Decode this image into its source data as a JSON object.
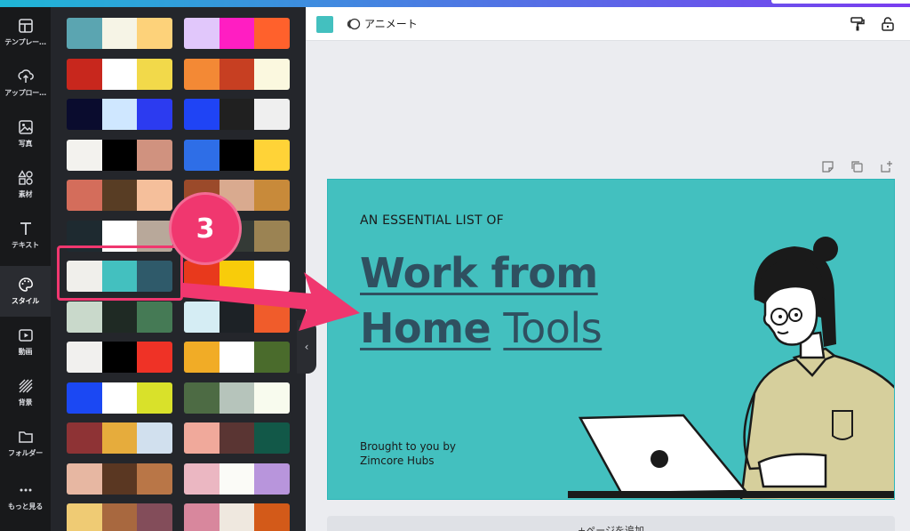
{
  "rail": {
    "items": [
      {
        "label": "テンプレー…",
        "icon": "template-icon"
      },
      {
        "label": "アップロー…",
        "icon": "upload-icon"
      },
      {
        "label": "写真",
        "icon": "photo-icon"
      },
      {
        "label": "素材",
        "icon": "elements-icon"
      },
      {
        "label": "テキスト",
        "icon": "text-icon"
      },
      {
        "label": "スタイル",
        "icon": "palette-icon"
      },
      {
        "label": "動画",
        "icon": "video-icon"
      },
      {
        "label": "背景",
        "icon": "background-icon"
      },
      {
        "label": "フォルダー",
        "icon": "folder-icon"
      },
      {
        "label": "もっと見る",
        "icon": "more-icon"
      }
    ]
  },
  "palettes": {
    "left": [
      [
        "#5ba5b1",
        "#f6f4e6",
        "#fdd27a"
      ],
      [
        "#c8271d",
        "#ffffff",
        "#f2d94a"
      ],
      [
        "#0a0c2e",
        "#cfe7ff",
        "#2c3bf0"
      ],
      [
        "#f3f2ee",
        "#000000",
        "#d0927f"
      ],
      [
        "#d46d5b",
        "#583d24",
        "#f5bf9b"
      ],
      [
        "#1e2a30",
        "#ffffff",
        "#b8a89a"
      ],
      [
        "#f0efeb",
        "#43c0bf",
        "#2f5a6a"
      ],
      [
        "#c9d9cb",
        "#1f2a24",
        "#457a55"
      ],
      [
        "#f1f0ee",
        "#000000",
        "#ef3226"
      ],
      [
        "#1b48f3",
        "#ffffff",
        "#d9e12a"
      ],
      [
        "#8e3335",
        "#e6ac3c",
        "#d1e0ee"
      ],
      [
        "#e7b7a2",
        "#5a3722",
        "#b97647"
      ],
      [
        "#efcb74",
        "#a8683f",
        "#834d5a"
      ]
    ],
    "right": [
      [
        "#e1c7fb",
        "#ff1ec2",
        "#ff612c"
      ],
      [
        "#f38935",
        "#c73f22",
        "#fbf8df"
      ],
      [
        "#1f44f5",
        "#202020",
        "#efefef"
      ],
      [
        "#2e6ee7",
        "#000000",
        "#ffd337"
      ],
      [
        "#9b4a2a",
        "#d9aa8f",
        "#c88a3a"
      ],
      [
        "#1e2a30",
        "#343a36",
        "#9b8353"
      ],
      [
        "#e8391c",
        "#f8cc0a",
        "#ffffff"
      ],
      [
        "#d5edf4",
        "#1d2226",
        "#f05c2b"
      ],
      [
        "#f1ac26",
        "#ffffff",
        "#4a6b2c"
      ],
      [
        "#4d6b44",
        "#b6c4bb",
        "#f8fbee"
      ],
      [
        "#f0a99b",
        "#5a3533",
        "#125848"
      ],
      [
        "#ebb7c2",
        "#fbfbf7",
        "#b895dc"
      ],
      [
        "#d8879d",
        "#efe8df",
        "#d35a19"
      ]
    ]
  },
  "toolbar": {
    "animate_label": "アニメート",
    "accent_color": "#43c0bf"
  },
  "design": {
    "subtitle": "AN ESSENTIAL LIST OF",
    "title_line1": "Work from",
    "title_line2_bold": "Home",
    "title_line2_light": "Tools",
    "credit_line1": "Brought to you by",
    "credit_line2": "Zimcore Hubs",
    "background_color": "#43c0bf"
  },
  "add_page_label": "+ページを追加",
  "annotation": {
    "step_number": "3",
    "color": "#f0376f"
  }
}
